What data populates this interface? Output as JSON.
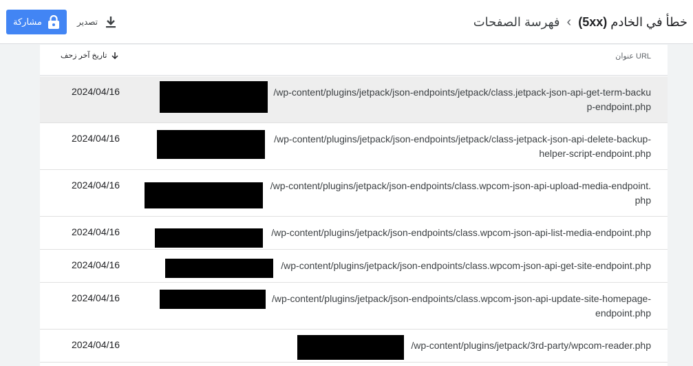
{
  "header": {
    "breadcrumb_parent": "فهرسة الصفحات",
    "breadcrumb_separator": "›",
    "title_text": "خطأ في الخادم",
    "title_code": "(5xx)",
    "share_label": "مشاركة",
    "export_label": "تصدير"
  },
  "table": {
    "col_url": "عنوان URL",
    "col_date": "تاريخ آخر زحف",
    "rows": [
      {
        "date": "2024/04/16",
        "url_line1": "/wp-content/plugins/jetpack/json-endpoints/jetpack/class.jetpack-json-api-get-term-backu",
        "url_line2": "p-endpoint.php"
      },
      {
        "date": "2024/04/16",
        "url_line1": "/wp-content/plugins/jetpack/json-endpoints/jetpack/class-jetpack-json-api-delete-backup-",
        "url_line2": "helper-script-endpoint.php"
      },
      {
        "date": "2024/04/16",
        "url_line1": "/wp-content/plugins/jetpack/json-endpoints/class.wpcom-json-api-upload-media-endpoint.",
        "url_line2": "php"
      },
      {
        "date": "2024/04/16",
        "url_line1": "/wp-content/plugins/jetpack/json-endpoints/class.wpcom-json-api-list-media-endpoint.php",
        "url_line2": ""
      },
      {
        "date": "2024/04/16",
        "url_line1": "/wp-content/plugins/jetpack/json-endpoints/class.wpcom-json-api-get-site-endpoint.php",
        "url_line2": ""
      },
      {
        "date": "2024/04/16",
        "url_line1": "/wp-content/plugins/jetpack/json-endpoints/class.wpcom-json-api-update-site-homepage-",
        "url_line2": "endpoint.php"
      },
      {
        "date": "2024/04/16",
        "url_line1": "/wp-content/plugins/jetpack/3rd-party/wpcom-reader.php",
        "url_line2": ""
      }
    ]
  }
}
